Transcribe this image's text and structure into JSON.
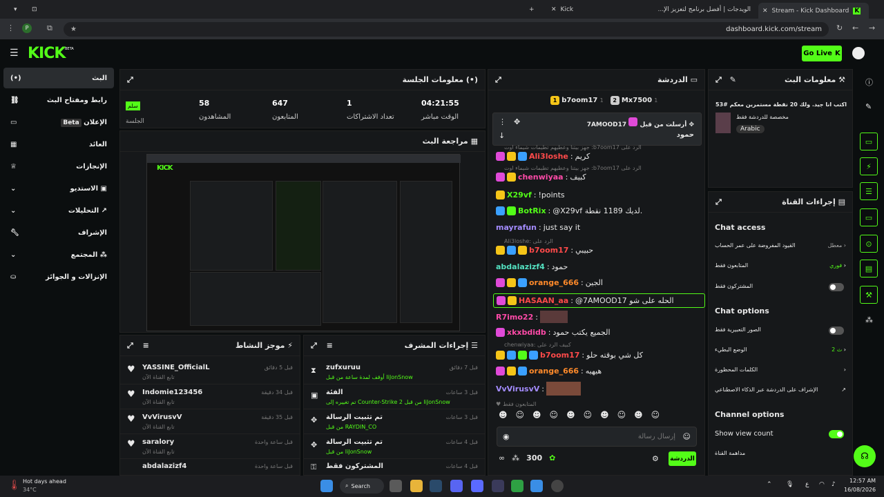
{
  "browser": {
    "tabs": [
      {
        "title": "Stream - Kick Dashboard",
        "active": true
      },
      {
        "title": "الويدجات | أفضل برنامج لتعزيز الإ...",
        "active": false
      },
      {
        "title": "Kick",
        "active": false
      }
    ],
    "url": "dashboard.kick.com/stream"
  },
  "header": {
    "logo": "KICK",
    "logo_beta": "BETA",
    "go_live": "Go Live"
  },
  "sidebar": {
    "items": [
      {
        "label": "البث",
        "icon": "broadcast-icon",
        "selected": true
      },
      {
        "label": "رابط ومفتاح البث",
        "icon": "link-icon"
      },
      {
        "label": "الإعلان",
        "badge": "Beta",
        "icon": "ad-icon"
      },
      {
        "label": "العائد",
        "icon": "revenue-icon"
      },
      {
        "label": "الإنجازات",
        "icon": "trophy-icon"
      },
      {
        "label": "الاستديو",
        "icon": "studio-icon"
      },
      {
        "label": "التحليلات",
        "icon": "analytics-icon"
      },
      {
        "label": "الإشراف",
        "icon": "wrench-icon"
      },
      {
        "label": "المجتمع",
        "icon": "community-icon"
      },
      {
        "label": "الإنزالات و الجوائز",
        "icon": "drops-icon"
      }
    ]
  },
  "session": {
    "title": "معلومات الجلسة",
    "badge": "سلم",
    "badge_label": "الجلسة",
    "stats": [
      {
        "value": "58",
        "label": "المشاهدون"
      },
      {
        "value": "647",
        "label": "المتابعون"
      },
      {
        "value": "1",
        "label": "تعداد الاشتراكات"
      },
      {
        "value": "04:21:55",
        "label": "الوقت مباشر"
      }
    ]
  },
  "preview": {
    "title": "مراجعة البث"
  },
  "activity": {
    "title": "موجز النشاط",
    "items": [
      {
        "name": "YASSINE_OfficialL",
        "sub": "تابع القناة الآن",
        "time": "قبل 5 دقائق"
      },
      {
        "name": "Indomie123456",
        "sub": "تابع القناة الآن",
        "time": "قبل 34 دقيقة"
      },
      {
        "name": "VvVirusvV",
        "sub": "تابع القناة الآن",
        "time": "قبل 35 دقيقة"
      },
      {
        "name": "saralory",
        "sub": "تابع القناة الآن",
        "time": "قبل ساعة واحدة"
      },
      {
        "name": "abdalazizf4",
        "sub": "",
        "time": "قبل ساعة واحدة"
      }
    ]
  },
  "modactions": {
    "title": "إجراءات المشرف",
    "items": [
      {
        "title": "zufxuruu",
        "detail": "أوقف لمدة ساعة من قبل IiJonSnow",
        "time": "قبل 7 دقائق",
        "icon": "hourglass-icon"
      },
      {
        "title": "الفئة",
        "detail": "تم تغييره إلى Counter-Strike 2 من قبل IiJonSnow",
        "time": "قبل 3 ساعات",
        "icon": "category-icon"
      },
      {
        "title": "تم تثبيت الرسالة",
        "detail": "من قبل RAYDIN_CO",
        "time": "قبل 3 ساعات",
        "icon": "pin-icon"
      },
      {
        "title": "تم تثبيت الرسالة",
        "detail": "من قبل IiJonSnow",
        "time": "قبل 4 ساعات",
        "icon": "pin-icon"
      },
      {
        "title": "المشتركون فقط",
        "detail": "",
        "time": "قبل 4 ساعات",
        "icon": "lock-icon"
      }
    ]
  },
  "chat": {
    "title": "الدردشة",
    "top_gifters": [
      {
        "name": "b7oom17",
        "count": "1",
        "rank": "1"
      },
      {
        "name": "Mx7500",
        "count": "1",
        "rank": "2"
      }
    ],
    "pinned": {
      "by": "أرسلت من قبل",
      "user": "7AMOOD17",
      "text": "حمود"
    },
    "messages": [
      {
        "reply": "جهز بيتنا وعطيهم تطيمات شيماء اوت :b7oom17 الرد على",
        "user": "Ali3loshe",
        "text": "كريم",
        "color": "#ff4a4a"
      },
      {
        "reply": "جهز بيتنا وعطيهم تطيمات شيماء اوت :b7oom17 الرد على",
        "user": "chenwiyaa",
        "text": "كبيف",
        "color": "#ff4aa8"
      },
      {
        "reply": "",
        "user": "X29vf",
        "text": "!points",
        "color": "#53fc18"
      },
      {
        "reply": "",
        "user": "BotRix",
        "text": "@X29vf لديك 1189 نقطة.",
        "color": "#53fc18"
      },
      {
        "reply": "",
        "user": "mayrafun",
        "text": "just say it",
        "color": "#a48cff"
      },
      {
        "reply": "Ali3loshe: الرد على",
        "user": "b7oom17",
        "text": "حبيبي",
        "color": "#ff4a4a"
      },
      {
        "reply": "",
        "user": "abdalazizf4",
        "text": "حمود",
        "color": "#53e0c0"
      },
      {
        "reply": "",
        "user": "orange_666",
        "text": "الجين",
        "color": "#ff8a2a"
      },
      {
        "reply": "",
        "user": "HASAAN_aa",
        "text": "@7AMOOD17 الحله على شو",
        "color": "#ff4a4a"
      },
      {
        "reply": "",
        "user": "R7imo22",
        "text": "",
        "color": "#ff4aa8"
      },
      {
        "reply": "",
        "user": "xkxbdidb",
        "text": "الجميع يكتب حمود",
        "color": "#ff4aa8"
      },
      {
        "reply": "chenwiyaa: كبيف الرد على",
        "user": "b7oom17",
        "text": "كل شي بوقته حلو",
        "color": "#ff4a4a"
      },
      {
        "reply": "",
        "user": "orange_666",
        "text": "هيهيه",
        "color": "#ff8a2a"
      },
      {
        "reply": "",
        "user": "VvVirusvV",
        "text": "",
        "color": "#a48cff"
      }
    ],
    "followers_only": "المتابعون فقط",
    "input_placeholder": "إرسال رسالة",
    "points": "300",
    "send": "الدردشة"
  },
  "streaminfo": {
    "title": "معلومات البث",
    "stream_title": "اكتب انا جيد. ولك 20 نقطة مستمرين معكم #53",
    "category": "مخصصة للدردشة فقط",
    "tag": "Arabic"
  },
  "channelactions": {
    "title": "إجراءات القناة",
    "chat_access": "Chat access",
    "access_rows": [
      {
        "label": "القيود المفروضة على عمر الحساب",
        "value": "معطل"
      },
      {
        "label": "المتابعون فقط",
        "value": "فوري"
      },
      {
        "label": "المشتركون فقط",
        "value": ""
      }
    ],
    "chat_options": "Chat options",
    "option_rows": [
      {
        "label": "الصور التعبيرية فقط",
        "value": ""
      },
      {
        "label": "الوضع البطيء",
        "value": "2 ث"
      },
      {
        "label": "الكلمات المحظورة",
        "value": ""
      },
      {
        "label": "الإشراف على الدردشة عبر الذكاء الاصطناعي",
        "value": ""
      }
    ],
    "channel_options": "Channel options",
    "show_view_count": "Show view count",
    "raid": "مداهمة القناة"
  },
  "taskbar": {
    "weather": "Hot days ahead",
    "temp": "34°C",
    "search": "Search",
    "time": "12:57 AM",
    "date": "16/08/2026",
    "lang": "ع"
  },
  "colors": {
    "accent": "#53fc18",
    "bg": "#0b0e0f",
    "panel": "#16181a"
  }
}
